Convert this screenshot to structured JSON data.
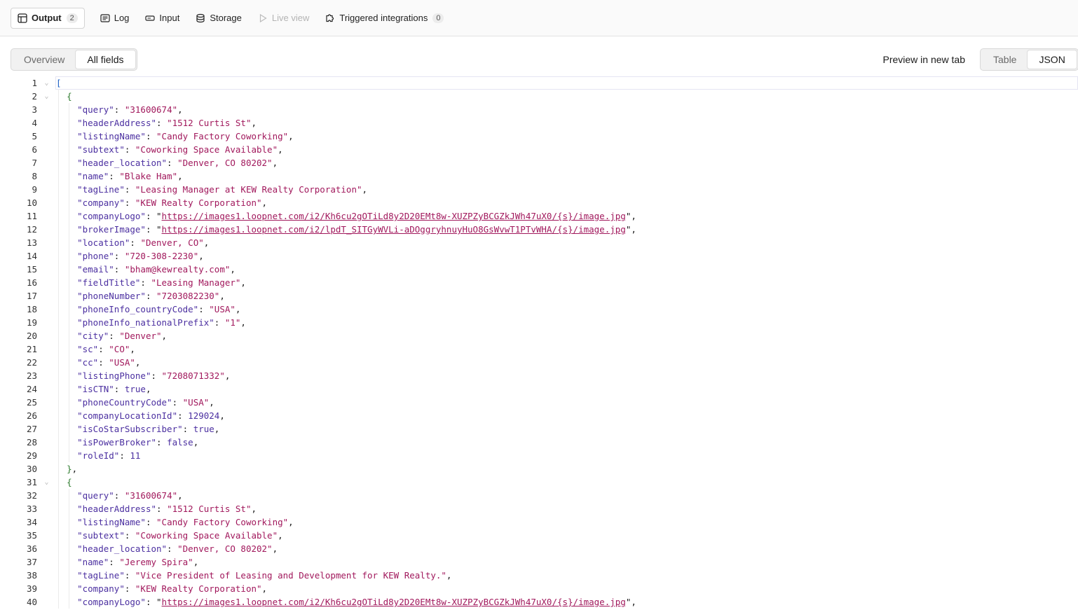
{
  "tabs": [
    {
      "label": "Output",
      "icon": "table-icon",
      "count": "2",
      "active": true
    },
    {
      "label": "Log",
      "icon": "log-icon"
    },
    {
      "label": "Input",
      "icon": "input-icon"
    },
    {
      "label": "Storage",
      "icon": "storage-icon"
    },
    {
      "label": "Live view",
      "icon": "play-icon",
      "disabled": true
    },
    {
      "label": "Triggered integrations",
      "icon": "puzzle-icon",
      "count": "0"
    }
  ],
  "view_toggle": {
    "overview": "Overview",
    "all_fields": "All fields",
    "selected": "All fields"
  },
  "preview_link": "Preview in new tab",
  "format_toggle": {
    "table": "Table",
    "json": "JSON",
    "selected": "JSON"
  },
  "records": [
    {
      "query": "31600674",
      "headerAddress": "1512 Curtis St",
      "listingName": "Candy Factory Coworking",
      "subtext": "Coworking Space Available",
      "header_location": "Denver, CO 80202",
      "name": "Blake Ham",
      "tagLine": "Leasing Manager at KEW Realty Corporation",
      "company": "KEW Realty Corporation",
      "companyLogo": "https://images1.loopnet.com/i2/Kh6cu2gOTiLd8y2D20EMt8w-XUZPZyBCGZkJWh47uX0/{s}/image.jpg",
      "brokerImage": "https://images1.loopnet.com/i2/lpdT_SITGyWVLi-aDOggryhnuyHuO8GsWvwT1PTvWHA/{s}/image.jpg",
      "location": "Denver, CO",
      "phone": "720-308-2230",
      "email": "bham@kewrealty.com",
      "fieldTitle": "Leasing Manager",
      "phoneNumber": "7203082230",
      "phoneInfo_countryCode": "USA",
      "phoneInfo_nationalPrefix": "1",
      "city": "Denver",
      "sc": "CO",
      "cc": "USA",
      "listingPhone": "7208071332",
      "isCTN": true,
      "phoneCountryCode": "USA",
      "companyLocationId": 129024,
      "isCoStarSubscriber": true,
      "isPowerBroker": false,
      "roleId": 11
    },
    {
      "query": "31600674",
      "headerAddress": "1512 Curtis St",
      "listingName": "Candy Factory Coworking",
      "subtext": "Coworking Space Available",
      "header_location": "Denver, CO 80202",
      "name": "Jeremy Spira",
      "tagLine": "Vice President of Leasing and Development for KEW Realty.",
      "company": "KEW Realty Corporation",
      "companyLogo": "https://images1.loopnet.com/i2/Kh6cu2gOTiLd8y2D20EMt8w-XUZPZyBCGZkJWh47uX0/{s}/image.jpg"
    }
  ],
  "visible_line_count": 40
}
